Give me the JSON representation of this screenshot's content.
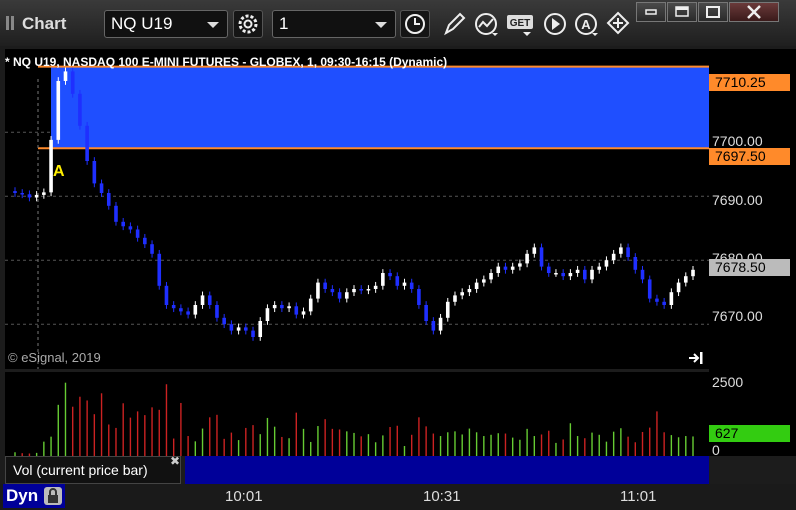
{
  "app": {
    "title": "Chart"
  },
  "toolbar": {
    "symbol": "NQ U19",
    "interval": "1",
    "icons": [
      "settings-gear-icon",
      "clock-icon",
      "pencil-icon",
      "study-icon",
      "get-icon",
      "play-icon",
      "alert-icon",
      "cursor-icon"
    ]
  },
  "window_buttons": [
    "restore-icon",
    "maximize-icon",
    "close-icon"
  ],
  "chart": {
    "title": "* NQ U19, NASDAQ 100 E-MINI FUTURES - GLOBEX, 1, 09:30-16:15 (Dynamic)",
    "copyright": "© eSignal, 2019",
    "y_labels": [
      "7700.00",
      "7690.00",
      "7680.00",
      "7670.00"
    ],
    "tags": {
      "upper": "7710.25",
      "lower": "7697.50",
      "last": "7678.50"
    },
    "marker_label": "A",
    "colors": {
      "up": "#ffffff",
      "down": "#1f2fff",
      "zone": "#1f4fff",
      "level_line": "#ff8a2a",
      "vol_up": "#66cc33",
      "vol_down": "#cc2222"
    }
  },
  "volume": {
    "labels": {
      "top": "2500",
      "bottom": "0"
    },
    "current": "627",
    "panel_title": "Vol (current price bar)"
  },
  "x_axis": {
    "labels": [
      "10:01",
      "10:31",
      "11:01"
    ]
  },
  "footer": {
    "mode": "Dyn"
  },
  "chart_data": {
    "type": "bar",
    "x": [
      "09:36",
      "09:37",
      "09:38",
      "09:39",
      "09:40",
      "09:41",
      "09:42",
      "09:43",
      "09:44",
      "09:45",
      "09:46",
      "09:47",
      "09:48",
      "09:49",
      "09:50",
      "09:51",
      "09:52",
      "09:53",
      "09:54",
      "09:55",
      "09:56",
      "09:57",
      "09:58",
      "09:59",
      "10:00",
      "10:01",
      "10:02",
      "10:03",
      "10:04",
      "10:05",
      "10:06",
      "10:07",
      "10:08",
      "10:09",
      "10:10",
      "10:11",
      "10:12",
      "10:13",
      "10:14",
      "10:15",
      "10:16",
      "10:17",
      "10:18",
      "10:19",
      "10:20",
      "10:21",
      "10:22",
      "10:23",
      "10:24",
      "10:25",
      "10:26",
      "10:27",
      "10:28",
      "10:29",
      "10:30",
      "10:31",
      "10:32",
      "10:33",
      "10:34",
      "10:35",
      "10:36",
      "10:37",
      "10:38",
      "10:39",
      "10:40",
      "10:41",
      "10:42",
      "10:43",
      "10:44",
      "10:45",
      "10:46",
      "10:47",
      "10:48",
      "10:49",
      "10:50",
      "10:51",
      "10:52",
      "10:53",
      "10:54",
      "10:55",
      "10:56",
      "10:57",
      "10:58",
      "10:59",
      "11:00",
      "11:01",
      "11:02",
      "11:03",
      "11:04",
      "11:05",
      "11:06",
      "11:07",
      "11:08",
      "11:09",
      "11:10"
    ],
    "close": [
      7690.5,
      7690.3,
      7689.8,
      7690.2,
      7690.6,
      7698.8,
      7708.0,
      7709.5,
      7706.0,
      7701.0,
      7695.5,
      7692.0,
      7690.5,
      7688.5,
      7686.0,
      7685.3,
      7684.8,
      7683.5,
      7682.5,
      7681.0,
      7676.0,
      7673.0,
      7672.5,
      7672.0,
      7671.5,
      7673.0,
      7674.5,
      7673.0,
      7671.0,
      7670.0,
      7669.0,
      7669.5,
      7669.0,
      7668.0,
      7670.5,
      7672.5,
      7673.0,
      7672.5,
      7672.8,
      7671.5,
      7672.0,
      7674.0,
      7676.5,
      7675.5,
      7675.0,
      7674.0,
      7675.0,
      7675.5,
      7675.3,
      7675.5,
      7676.0,
      7678.0,
      7677.5,
      7676.0,
      7676.5,
      7675.5,
      7673.0,
      7670.5,
      7669.0,
      7671.0,
      7673.5,
      7674.5,
      7675.0,
      7675.5,
      7676.5,
      7677.0,
      7678.0,
      7679.0,
      7678.5,
      7679.0,
      7679.5,
      7681.0,
      7682.0,
      7679.0,
      7678.0,
      7678.0,
      7677.5,
      7678.0,
      7678.5,
      7677.0,
      7678.5,
      7679.0,
      7680.0,
      7681.0,
      7682.0,
      7680.5,
      7678.5,
      7677.0,
      7674.0,
      7673.5,
      7673.0,
      7675.0,
      7676.5,
      7677.5,
      7678.5
    ],
    "volume": [
      120,
      90,
      80,
      100,
      460,
      620,
      1640,
      2350,
      1580,
      1900,
      1780,
      1340,
      2010,
      1010,
      900,
      1690,
      1230,
      1430,
      1310,
      1560,
      1480,
      2300,
      560,
      1700,
      640,
      470,
      880,
      1240,
      1320,
      550,
      750,
      510,
      900,
      990,
      700,
      1220,
      940,
      610,
      570,
      1390,
      870,
      450,
      960,
      1180,
      870,
      850,
      790,
      740,
      630,
      700,
      440,
      660,
      930,
      970,
      320,
      680,
      1240,
      950,
      720,
      640,
      760,
      790,
      690,
      880,
      760,
      640,
      680,
      730,
      720,
      590,
      520,
      870,
      640,
      690,
      810,
      420,
      530,
      1050,
      640,
      570,
      750,
      680,
      460,
      780,
      890,
      620,
      440,
      770,
      910,
      1430,
      760,
      670,
      600,
      640,
      627
    ],
    "ylim": [
      7663,
      7713
    ],
    "vol_ylim": [
      0,
      2500
    ],
    "levels": [
      7710.25,
      7697.5
    ]
  }
}
